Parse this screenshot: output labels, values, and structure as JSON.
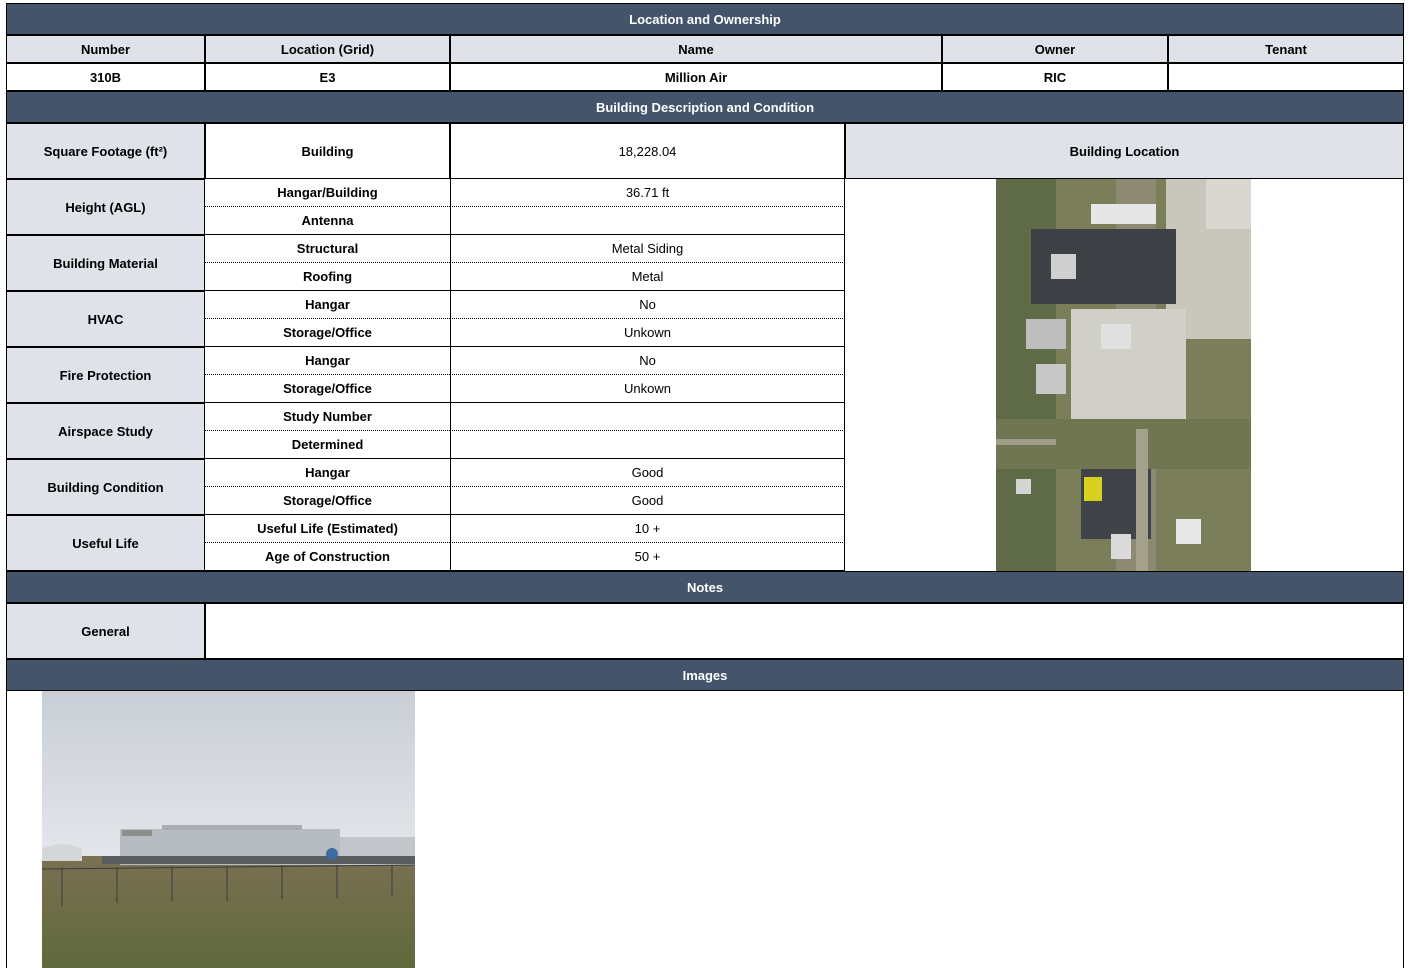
{
  "sections": {
    "location": "Location and Ownership",
    "description": "Building Description and Condition",
    "notes": "Notes",
    "images": "Images"
  },
  "ownership": {
    "headers": [
      "Number",
      "Location (Grid)",
      "Name",
      "Owner",
      "Tenant"
    ],
    "values": [
      "310B",
      "E3",
      "Million Air",
      "RIC",
      ""
    ]
  },
  "square_footage": {
    "label": "Square Footage (ft²)",
    "sub": "Building",
    "value": "18,228.04"
  },
  "building_location": "Building Location",
  "groups": [
    {
      "label": "Height (AGL)",
      "rows": [
        {
          "sub": "Hangar/Building",
          "value": "36.71 ft"
        },
        {
          "sub": "Antenna",
          "value": ""
        }
      ]
    },
    {
      "label": "Building Material",
      "rows": [
        {
          "sub": "Structural",
          "value": "Metal Siding"
        },
        {
          "sub": "Roofing",
          "value": "Metal"
        }
      ]
    },
    {
      "label": "HVAC",
      "rows": [
        {
          "sub": "Hangar",
          "value": "No"
        },
        {
          "sub": "Storage/Office",
          "value": "Unkown"
        }
      ]
    },
    {
      "label": "Fire Protection",
      "rows": [
        {
          "sub": "Hangar",
          "value": "No"
        },
        {
          "sub": "Storage/Office",
          "value": "Unkown"
        }
      ]
    },
    {
      "label": "Airspace Study",
      "rows": [
        {
          "sub": "Study Number",
          "value": ""
        },
        {
          "sub": "Determined",
          "value": ""
        }
      ]
    },
    {
      "label": "Building Condition",
      "rows": [
        {
          "sub": "Hangar",
          "value": "Good"
        },
        {
          "sub": "Storage/Office",
          "value": "Good"
        }
      ]
    },
    {
      "label": "Useful Life",
      "rows": [
        {
          "sub": "Useful Life (Estimated)",
          "value": "10 +"
        },
        {
          "sub": "Age of Construction",
          "value": "50 +"
        }
      ]
    }
  ],
  "notes": {
    "label": "General",
    "value": ""
  },
  "colors": {
    "header": "#44546a",
    "label_fill": "#dfe2e8"
  }
}
